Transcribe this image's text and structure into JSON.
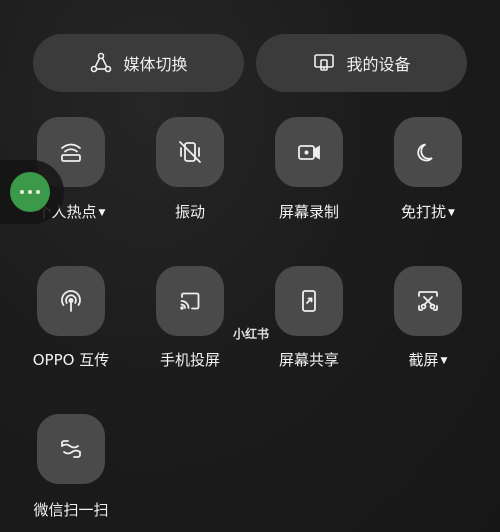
{
  "top_buttons": {
    "media_switch": "媒体切换",
    "my_devices": "我的设备"
  },
  "tiles": {
    "hotspot": "个人热点",
    "vibrate": "振动",
    "screen_record": "屏幕录制",
    "dnd": "免打扰",
    "oppo_share": "OPPO 互传",
    "screen_cast": "手机投屏",
    "screen_share": "屏幕共享",
    "screenshot": "截屏",
    "wechat_scan": "微信扫一扫"
  },
  "watermark": "小红书",
  "icons": [
    "media-switch-icon",
    "my-devices-icon",
    "hotspot-icon",
    "vibrate-off-icon",
    "screen-record-icon",
    "moon-icon",
    "oppo-share-icon",
    "cast-icon",
    "screen-share-icon",
    "screenshot-icon",
    "wechat-scan-icon",
    "more-dots-icon"
  ]
}
